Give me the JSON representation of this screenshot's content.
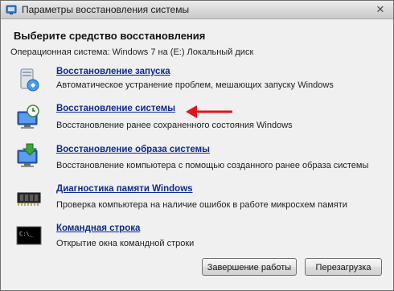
{
  "window": {
    "title": "Параметры восстановления системы",
    "close_glyph": "✕"
  },
  "heading": "Выберите средство восстановления",
  "os_line": "Операционная система: Windows 7 на (E:) Локальный диск",
  "tools": [
    {
      "label": "Восстановление запуска",
      "description": "Автоматическое устранение проблем, мешающих запуску Windows",
      "icon": "startup-repair-icon"
    },
    {
      "label": "Восстановление системы",
      "description": "Восстановление ранее сохраненного состояния Windows",
      "icon": "system-restore-icon"
    },
    {
      "label": "Восстановление образа системы",
      "description": "Восстановление компьютера с помощью  созданного ранее образа системы",
      "icon": "system-image-recovery-icon"
    },
    {
      "label": "Диагностика памяти Windows",
      "description": "Проверка компьютера на наличие ошибок в работе микросхем памяти",
      "icon": "memory-diagnostic-icon"
    },
    {
      "label": "Командная строка",
      "description": "Открытие окна командной строки",
      "icon": "command-prompt-icon",
      "console_text": "C:\\_"
    }
  ],
  "buttons": {
    "shutdown": "Завершение работы",
    "restart": "Перезагрузка"
  },
  "colors": {
    "link": "#0b2a8c",
    "annotation_arrow": "#e0141b"
  }
}
